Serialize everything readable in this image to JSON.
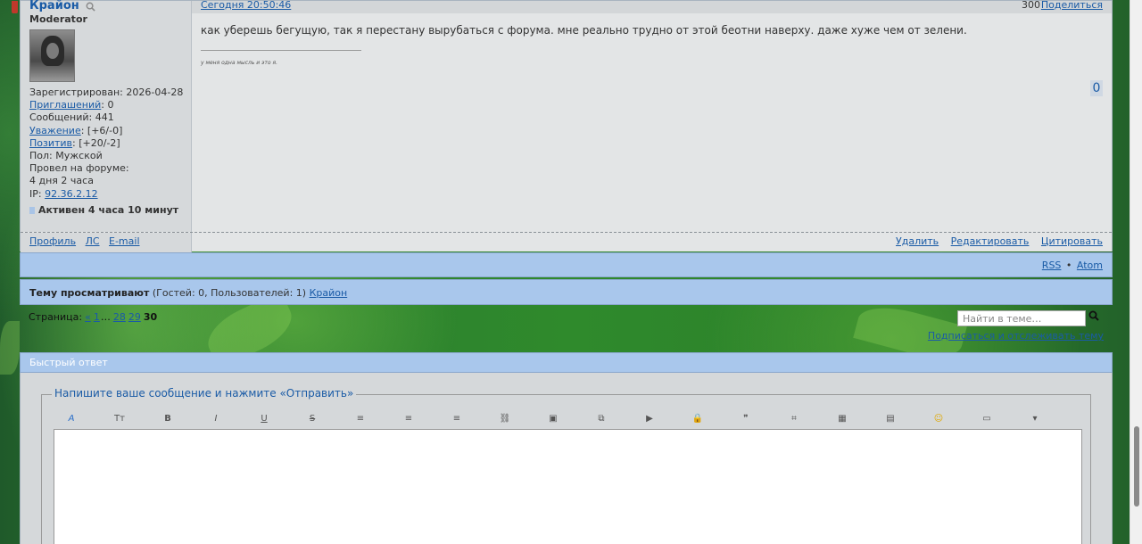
{
  "post": {
    "author": {
      "name": "Крайон",
      "role": "Moderator",
      "registered_label": "Зарегистрирован:",
      "registered_value": "2026-04-28",
      "invites_label": "Приглашений",
      "invites_value": ": 0",
      "messages_label": "Сообщений:",
      "messages_value": "441",
      "respect_label": "Уважение",
      "respect_value": ": [+6/-0]",
      "positive_label": "Позитив",
      "positive_value": ": [+20/-2]",
      "gender_label": "Пол:",
      "gender_value": "Мужской",
      "time_label": "Провел на форуме:",
      "time_value": "4 дня 2 часа",
      "ip_label": "IP:",
      "ip_value": "92.36.2.12",
      "online": "Активен 4 часа 10 минут"
    },
    "date": "Сегодня 20:50:46",
    "number": "300",
    "share": "Поделиться",
    "text": "как уберешь бегущую, так я перестану вырубаться с форума. мне реально трудно от этой беотни наверху. даже хуже чем от зелени.",
    "signature": "у меня одна мысль и это я.",
    "rep": "0",
    "footer_left": [
      "Профиль",
      "ЛС",
      "E-mail"
    ],
    "footer_right": [
      "Удалить",
      "Редактировать",
      "Цитировать"
    ]
  },
  "feeds": {
    "rss": "RSS",
    "sep": "•",
    "atom": "Atom"
  },
  "viewers": {
    "label": "Тему просматривают",
    "counts": "(Гостей: 0, Пользователей: 1)",
    "user": "Крайон"
  },
  "pagination": {
    "label": "Страница:",
    "prev": "«",
    "first": "1",
    "dots": "…",
    "p28": "28",
    "p29": "29",
    "current": "30"
  },
  "topic_search": {
    "placeholder": "Найти в теме…"
  },
  "subscribe": "Подписаться и отслеживать тему",
  "quick_reply": {
    "title": "Быстрый ответ",
    "legend": "Напишите ваше сообщение и нажмите «Отправить»",
    "toolbar": [
      {
        "icon": "font-color-icon",
        "glyph": "A"
      },
      {
        "icon": "font-size-icon",
        "glyph": "Tт"
      },
      {
        "icon": "bold-icon",
        "glyph": "B"
      },
      {
        "icon": "italic-icon",
        "glyph": "I"
      },
      {
        "icon": "underline-icon",
        "glyph": "U"
      },
      {
        "icon": "strikethrough-icon",
        "glyph": "S"
      },
      {
        "icon": "align-left-icon",
        "glyph": "≡"
      },
      {
        "icon": "align-center-icon",
        "glyph": "≡"
      },
      {
        "icon": "align-right-icon",
        "glyph": "≡"
      },
      {
        "icon": "link-icon",
        "glyph": "⛓"
      },
      {
        "icon": "image-icon",
        "glyph": "▣"
      },
      {
        "icon": "gallery-icon",
        "glyph": "⧉"
      },
      {
        "icon": "video-icon",
        "glyph": "▶"
      },
      {
        "icon": "hide-icon",
        "glyph": "🔒"
      },
      {
        "icon": "quote-icon",
        "glyph": "❞"
      },
      {
        "icon": "code-icon",
        "glyph": "⌗"
      },
      {
        "icon": "table-icon",
        "glyph": "▦"
      },
      {
        "icon": "spoiler-icon",
        "glyph": "▤"
      },
      {
        "icon": "smiley-icon",
        "glyph": "☺"
      },
      {
        "icon": "more-tools-icon",
        "glyph": "▭"
      },
      {
        "icon": "dropdown-arrow-icon",
        "glyph": "▾"
      }
    ]
  },
  "colors": {
    "panel": "#e3e5e6",
    "sidebar": "#d6d9db",
    "bar": "#a9c7ec",
    "link": "#1a5ba6"
  }
}
